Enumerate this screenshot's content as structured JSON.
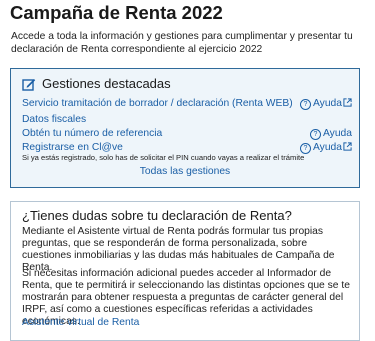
{
  "page": {
    "title": "Campaña de Renta 2022",
    "intro": "Accede a toda la información y gestiones para cumplimentar y presentar tu declaración de Renta correspondiente al ejercicio 2022"
  },
  "gestiones": {
    "icon": "edit-icon",
    "title": "Gestiones destacadas",
    "items": [
      {
        "label": "Servicio tramitación de borrador / declaración (Renta WEB)",
        "help": "Ayuda",
        "external": true
      },
      {
        "label": "Datos fiscales",
        "help": "",
        "external": false
      },
      {
        "label": "Obtén tu número de referencia",
        "help": "Ayuda",
        "external": false
      },
      {
        "label": "Registrarse en Cl@ve",
        "help": "Ayuda",
        "external": true
      }
    ],
    "pin_note": "Si ya estás registrado, solo has de solicitar el PIN cuando vayas a realizar el trámite",
    "all_link": "Todas las gestiones"
  },
  "dudas": {
    "title": "¿Tienes dudas sobre tu declaración de Renta?",
    "para1": "Mediante el Asistente virtual de Renta podrás formular tus propias preguntas, que se responderán de forma personalizada, sobre cuestiones inmobiliarias y las dudas más habituales de Campaña de Renta.",
    "para2": "Si necesitas información adicional puedes acceder al Informador de Renta, que te permitirá ir seleccionando las distintas opciones que se te mostrarán para obtener respuesta a preguntas de carácter general del IRPF, así como a cuestiones específicas referidas a actividades económicas.",
    "link": "Asistente virtual de Renta"
  },
  "colors": {
    "link": "#1b5fa6",
    "card_background": "#eef5fa",
    "card_border": "#2f6a9a"
  }
}
